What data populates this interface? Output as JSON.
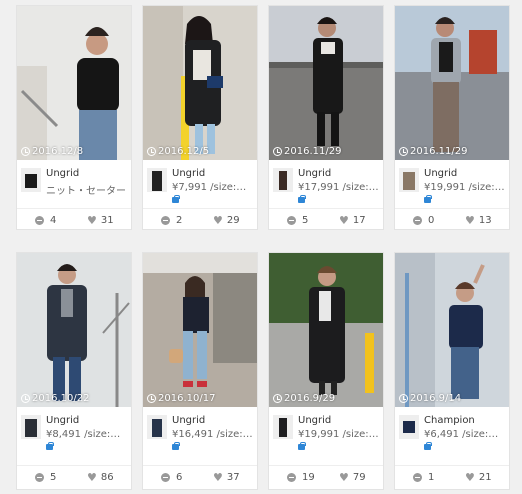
{
  "cards": [
    {
      "date": "2016.12/8",
      "brand": "Ungrid",
      "sub": "ニット・セーター",
      "comments": "4",
      "likes": "31",
      "bag": false
    },
    {
      "date": "2016.12/5",
      "brand": "Ungrid",
      "sub": "¥7,991 /size:…",
      "comments": "2",
      "likes": "29",
      "bag": true
    },
    {
      "date": "2016.11/29",
      "brand": "Ungrid",
      "sub": "¥17,991 /size:…",
      "comments": "5",
      "likes": "17",
      "bag": true
    },
    {
      "date": "2016.11/29",
      "brand": "Ungrid",
      "sub": "¥19,991 /size:…",
      "comments": "0",
      "likes": "13",
      "bag": true
    },
    {
      "date": "2016.10/22",
      "brand": "Ungrid",
      "sub": "¥8,491 /size:…",
      "comments": "5",
      "likes": "86",
      "bag": true
    },
    {
      "date": "2016.10/17",
      "brand": "Ungrid",
      "sub": "¥16,491 /size:…",
      "comments": "6",
      "likes": "37",
      "bag": true
    },
    {
      "date": "2016.9/29",
      "brand": "Ungrid",
      "sub": "¥19,991 /size:…",
      "comments": "19",
      "likes": "79",
      "bag": true
    },
    {
      "date": "2016.9/14",
      "brand": "Champion",
      "sub": "¥6,491 /size:…",
      "comments": "1",
      "likes": "21",
      "bag": true
    }
  ],
  "colors": {
    "accent": "#2e86d6",
    "text": "#333333",
    "muted": "#999999"
  }
}
